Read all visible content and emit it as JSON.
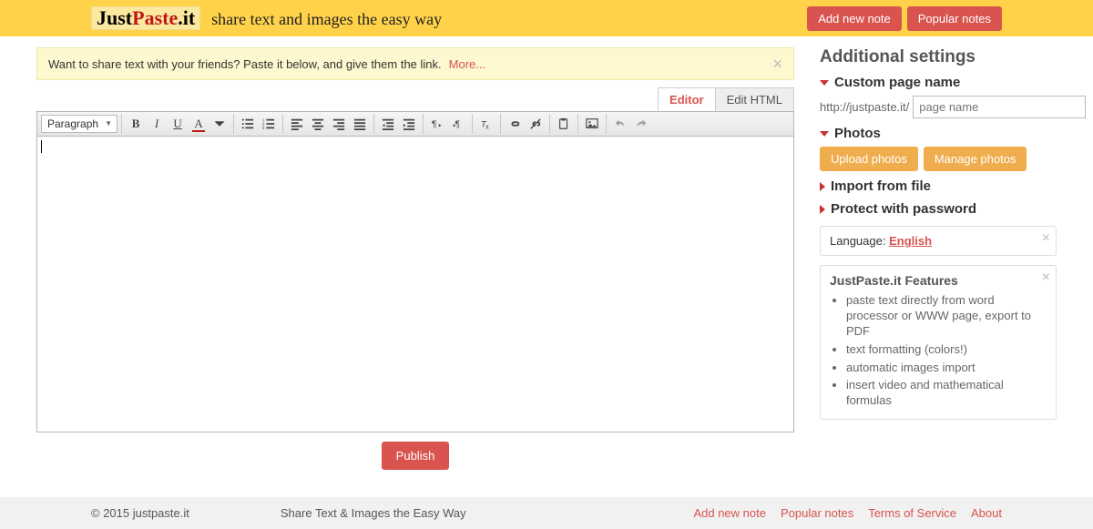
{
  "header": {
    "logo": {
      "just": "Just",
      "paste": "Paste",
      "dot": ".",
      "it": "it"
    },
    "tagline": "share text and images the easy way",
    "add_note": "Add new note",
    "popular": "Popular notes"
  },
  "tip": {
    "text": "Want to share text with your friends? Paste it below, and give them the link.",
    "more": "More..."
  },
  "tabs": {
    "editor": "Editor",
    "html": "Edit HTML"
  },
  "toolbar": {
    "paragraph": "Paragraph",
    "bold": "B",
    "italic": "I",
    "underline": "U",
    "color": "A"
  },
  "publish": "Publish",
  "sidebar": {
    "title": "Additional settings",
    "custom_page": "Custom page name",
    "url_prefix": "http://justpaste.it/",
    "page_name_placeholder": "page name",
    "photos": "Photos",
    "upload": "Upload photos",
    "manage": "Manage photos",
    "import": "Import from file",
    "protect": "Protect with password",
    "language_label": "Language:",
    "language": "English",
    "features_title": "JustPaste.it Features",
    "features": [
      "paste text directly from word processor or WWW page, export to PDF",
      "text formatting (colors!)",
      "automatic images import",
      "insert video and mathematical formulas"
    ]
  },
  "footer": {
    "copyright": "© 2015 justpaste.it",
    "slogan": "Share Text & Images the Easy Way",
    "links": {
      "add": "Add new note",
      "popular": "Popular notes",
      "tos": "Terms of Service",
      "about": "About"
    }
  }
}
